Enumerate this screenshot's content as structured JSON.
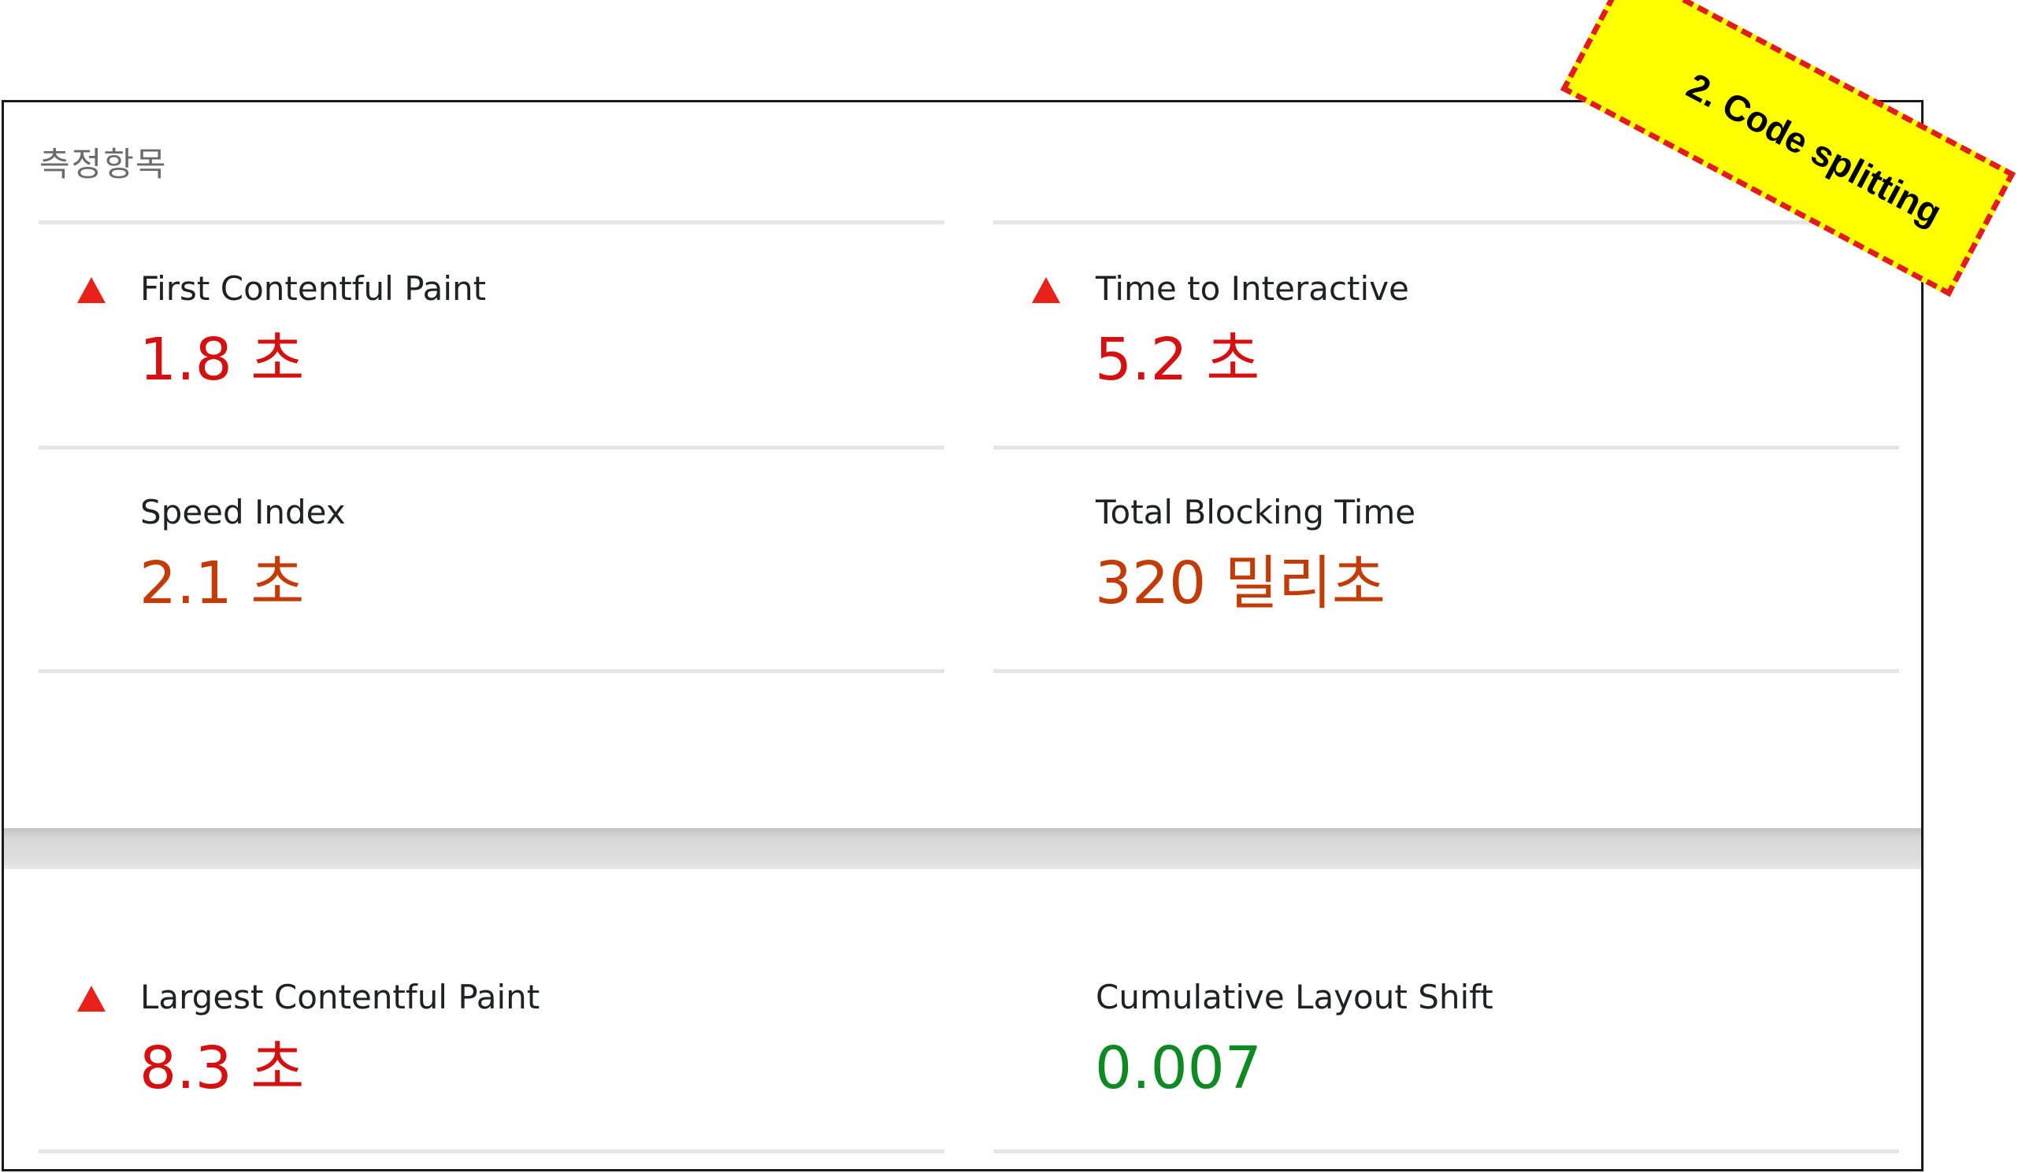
{
  "section": {
    "title": "측정항목"
  },
  "metrics": [
    {
      "label": "First Contentful Paint",
      "value": "1.8 초",
      "status": "fail"
    },
    {
      "label": "Time to Interactive",
      "value": "5.2 초",
      "status": "fail"
    },
    {
      "label": "Speed Index",
      "value": "2.1 초",
      "status": "average"
    },
    {
      "label": "Total Blocking Time",
      "value": "320 밀리초",
      "status": "average"
    },
    {
      "label": "Largest Contentful Paint",
      "value": "8.3 초",
      "status": "fail"
    },
    {
      "label": "Cumulative Layout Shift",
      "value": "0.007",
      "status": "pass"
    }
  ],
  "annotation": {
    "text": "2. Code splitting"
  },
  "colors": {
    "fail": "#d41010",
    "average": "#c33b06",
    "pass": "#0e8a22",
    "fail_icon": "#e8221a",
    "sticker_fill": "#ffff00",
    "sticker_border": "#e21b1b"
  },
  "icons": {
    "fail_indicator": "triangle-up-icon"
  }
}
